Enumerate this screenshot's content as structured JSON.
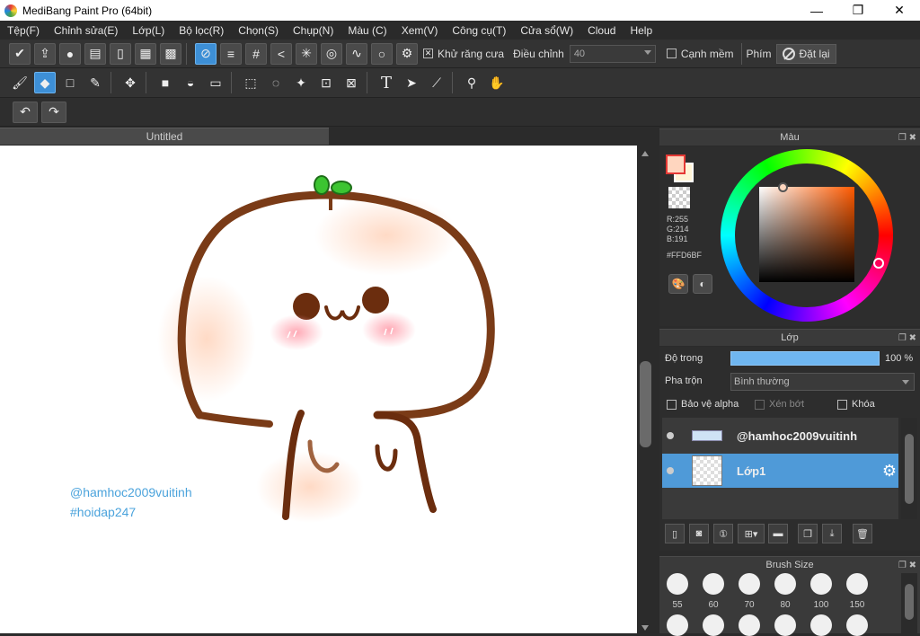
{
  "window": {
    "title": "MediBang Paint Pro (64bit)",
    "minimize": "—",
    "maximize": "❐",
    "close": "✕"
  },
  "menu": [
    "Tệp(F)",
    "Chỉnh sửa(E)",
    "Lớp(L)",
    "Bộ lọc(R)",
    "Chọn(S)",
    "Chụp(N)",
    "Màu (C)",
    "Xem(V)",
    "Công cụ(T)",
    "Cửa sổ(W)",
    "Cloud",
    "Help"
  ],
  "toolbar1": {
    "antialias_label": "Khử răng cưa",
    "antialias_checked": true,
    "adjust_label": "Điều chỉnh",
    "adjust_value": "40",
    "soft_edge_label": "Cạnh mềm",
    "soft_edge_checked": false,
    "key_label": "Phím",
    "reset_label": "Đặt lại"
  },
  "document": {
    "tab_title": "Untitled"
  },
  "canvas": {
    "watermark_line1": "@hamhoc2009vuitinh",
    "watermark_line2": "#hoidap247"
  },
  "color_panel": {
    "title": "Màu",
    "r": "R:255",
    "g": "G:214",
    "b": "B:191",
    "hex": "#FFD6BF",
    "primary_color": "#FFD6BF",
    "secondary_color": "#FFF4D6"
  },
  "layer_panel": {
    "title": "Lớp",
    "opacity_label": "Độ trong",
    "opacity_value": "100 %",
    "opacity_fraction": 1.0,
    "blend_label": "Pha trộn",
    "blend_value": "Bình thường",
    "protect_alpha": "Bảo vệ alpha",
    "clipping": "Xén bớt",
    "lock": "Khóa",
    "layers": [
      {
        "name": "@hamhoc2009vuitinh",
        "selected": false
      },
      {
        "name": "Lớp1",
        "selected": true
      }
    ]
  },
  "brush_panel": {
    "title": "Brush Size",
    "sizes": [
      "55",
      "60",
      "70",
      "80",
      "100",
      "150"
    ]
  }
}
